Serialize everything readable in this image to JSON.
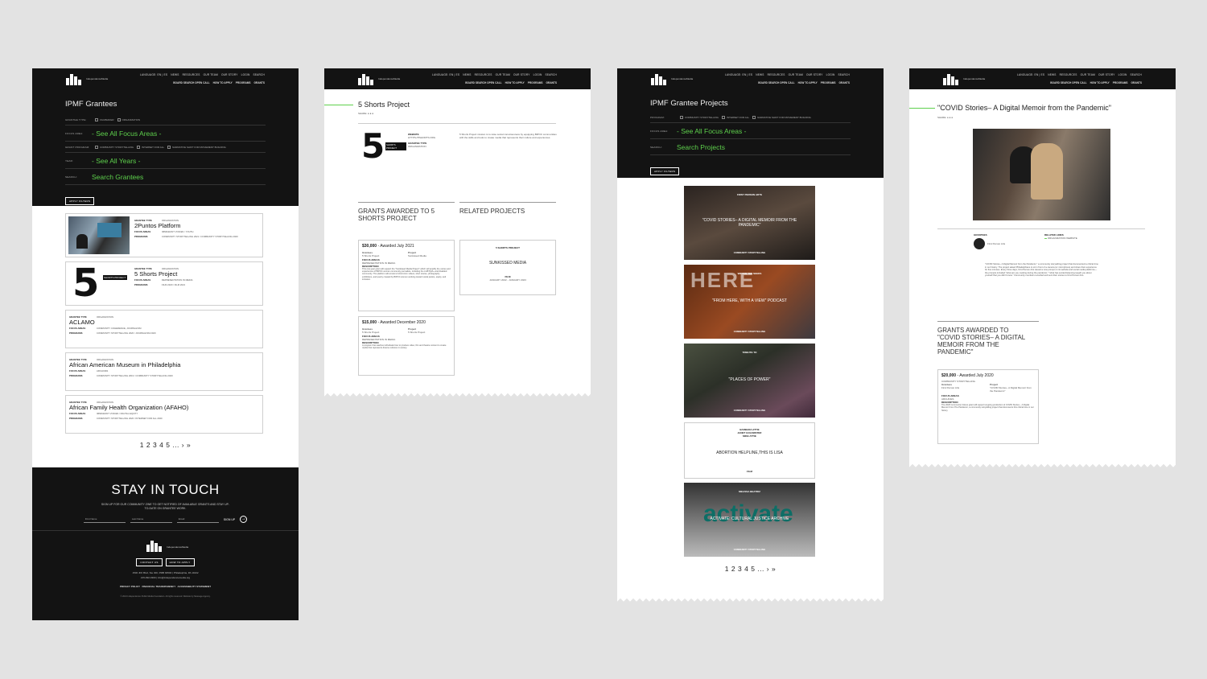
{
  "common": {
    "logo_text": "IndependenceMedia",
    "top_links": [
      "LANGUAGE: EN | ES",
      "NEWS",
      "RESOURCES",
      "OUR TEAM",
      "OUR STORY",
      "LOGIN",
      "SEARCH"
    ],
    "sub_links": [
      "BOARD SEARCH OPEN CALL",
      "HOW TO APPLY",
      "PROGRAMS",
      "GRANTS"
    ],
    "share_label": "SHARE:"
  },
  "panel1": {
    "title": "IPMF Grantees",
    "filters": {
      "grantee_type_label": "GRANTEE TYPE:",
      "grantee_type_options": [
        "FILMMAKER",
        "ORGANIZATION"
      ],
      "focus_area_label": "FOCUS AREA:",
      "focus_area_value": "- See All Focus Areas -",
      "grant_program_label": "GRANT PROGRAM:",
      "grant_program_options": [
        "COMMUNITY STORYTELLING",
        "INTERNET FOR ALL",
        "NARRATIVE SHIFT FOR MOVEMENT BUILDING"
      ],
      "year_label": "YEAR:",
      "year_value": "- See All Years -",
      "search_label": "SEARCH:",
      "search_value": "Search Grantees",
      "apply_label": "APPLY FILTERS"
    },
    "grantees": [
      {
        "type_label": "GRANTEE TYPE",
        "type": "ORGANIZATION",
        "name": "2Puntos Platform",
        "focus_label": "FOCUS AREAS",
        "focus": "IMMIGRANT VOICES / YOUTH",
        "programs_label": "PROGRAMS",
        "programs": "COMMUNITY STORYTELLING 2021 / COMMUNITY STORYTELLING 2020"
      },
      {
        "type_label": "GRANTEE TYPE",
        "type": "ORGANIZATION",
        "name": "5 Shorts Project",
        "focus_label": "FOCUS AREAS",
        "focus": "REPRESENTATION IN MEDIA",
        "programs_label": "PROGRAMS",
        "programs": "FILM 2020 / FILM 2021"
      },
      {
        "type_label": "GRANTEE TYPE",
        "type": "ORGANIZATION",
        "name": "ACLAMO",
        "focus_label": "FOCUS AREAS",
        "focus": "COMMUNITY COHERENCE, JOURNALISM",
        "programs_label": "PROGRAMS",
        "programs": "COMMUNITY STORYTELLING 2020 / JOURNALISM 2020"
      },
      {
        "type_label": "GRANTEE TYPE",
        "type": "ORGANIZATION",
        "name": "African American Museum in Philadelphia",
        "focus_label": "FOCUS AREAS",
        "focus": "ARCHIVES",
        "programs_label": "PROGRAMS",
        "programs": "COMMUNITY STORYTELLING 2019 / COMMUNITY STORYTELLING 2020"
      },
      {
        "type_label": "GRANTEE TYPE",
        "type": "ORGANIZATION",
        "name": "African Family Health Organization (AFAHO)",
        "focus_label": "FOCUS AREAS",
        "focus": "IMMIGRANT VOICES / DIGITAL EQUITY",
        "programs_label": "PROGRAMS",
        "programs": "COMMUNITY STORYTELLING 2020 / INTERNET FOR ALL 2020"
      }
    ],
    "pager": [
      "1",
      "2",
      "3",
      "4",
      "5",
      "...",
      "›",
      "»"
    ],
    "footer": {
      "heading": "STAY IN TOUCH",
      "subtext": "SIGN UP FOR OUR COMMUNITY ZINE TO GET NOTIFIED OF AVAILABLE GRANTS AND STAY UP-TO-DATE ON GRANTEE WORK.",
      "first_name_placeholder": "First Name",
      "last_name_placeholder": "Last Name",
      "email_placeholder": "Email",
      "signup_label": "SIGN UP",
      "contact_label": "CONTACT US",
      "apply_label": "HOW TO APPLY",
      "address": "1500 JFK Blvd, Ste 300, PMB 90500 | Philadelphia, PA 19102",
      "contact_line": "215-992-0300 | info@independencemedia.org",
      "legal_links": [
        "PRIVACY POLICY",
        "FINANCIAL TRANSPARENCY",
        "ACCESSIBILITY STATEMENT"
      ],
      "copyright": "© 2021 Independence Public Media Foundation. All rights reserved. Website by Message Agency."
    }
  },
  "panel2": {
    "title": "5 Shorts Project",
    "logo_big": "5",
    "logo_small": "SHORTS PROJECT",
    "website_label": "WEBSITE",
    "website": "HTTPS://5SHORTS.ORG",
    "grantee_type_label": "GRANTEE TYPE",
    "grantee_type": "ORGANIZATION",
    "description": "5 Shorts Project mission is to raise social consciousness by equipping BIPOC communities with the skills and tools to create media that represents their culture and experiences.",
    "grants_heading": "GRANTS AWARDED TO 5 SHORTS PROJECT",
    "related_heading": "RELATED PROJECTS",
    "grants": [
      {
        "amount": "$30,000",
        "awarded": "- Awarded July 2021",
        "grantees_label": "Grantees",
        "grantees": "5 Shorts Project",
        "project_label": "Project",
        "project": "Sunkissed Media",
        "focus_label": "FOCUS AREAS",
        "focus": "REPRESENTATION IN MEDIA",
        "desc_label": "DESCRIPTION",
        "desc": "This one-year grant will support the \"Sunkissed Media Project\" which will amplify the voices and experiences of BIPOC women community journalists, including the LGBTQIA+ and disabled community. The platform will consist of short-form videos, short stories, photography exhibitions, and poetry created by BIPOC women working toward social justice, equity, and inclusion."
      },
      {
        "amount": "$15,000",
        "awarded": "- Awarded December 2020",
        "grantees_label": "Grantees",
        "grantees": "5 Shorts Project",
        "project_label": "Project",
        "project": "5 Shorts Project",
        "focus_label": "FOCUS AREAS",
        "focus": "REPRESENTATION IN MEDIA",
        "desc_label": "DESCRIPTION",
        "desc": "A program that teaches individuals how to produce video, film and theatre content to create media that represents diverse cultures in society."
      }
    ],
    "related": {
      "by": "5 SHORTS PROJECT",
      "title": "SUNKISSED MEDIA",
      "category": "FILM",
      "dates": "JANUARY 2022 - JANUARY 2023"
    }
  },
  "panel3": {
    "title": "IPMF Grantee Projects",
    "program_label": "PROGRAM:",
    "program_options": [
      "COMMUNITY STORYTELLING",
      "INTERNET FOR ALL",
      "NARRATIVE SHIFT FOR MOVEMENT BUILDING"
    ],
    "focus_label": "FOCUS AREA:",
    "focus_value": "- See All Focus Areas -",
    "search_label": "SEARCH:",
    "search_value": "Search Projects",
    "apply_label": "APPLY FILTERS",
    "projects": [
      {
        "by": "FIRST PERSON ARTS",
        "title": "\"COVID STORIES– A DIGITAL MEMOIR FROM THE PANDEMIC\"",
        "category": "COMMUNITY STORYTELLING",
        "bg": "#3b3430"
      },
      {
        "by": "WE ARE THE SEEDS",
        "title": "\"FROM HERE, WITH A VIEW\" PODCAST",
        "category": "COMMUNITY STORYTELLING",
        "bg": "#7a3a1c",
        "bg_word": "HERE"
      },
      {
        "by": "TRIBUTE TO",
        "title": "\"PLACES OF POWER\"",
        "category": "COMMUNITY STORYTELLING",
        "bg": "#3e4338"
      },
      {
        "by": "BARBARA ATTIE\nJANET GOLDWATER\nMIKE ATTIE",
        "title": "ABORTION HELPLINE,THIS IS LISA",
        "category": "FILM",
        "bg": "#ffffff"
      },
      {
        "by": "MELISSA BEATRIZ",
        "title": "ACTIVATE: CULTURAL JUSTICE ARCHIVE",
        "category": "COMMUNITY STORYTELLING",
        "bg": "#555555",
        "bg_word": "activate"
      }
    ],
    "pager": [
      "1",
      "2",
      "3",
      "4",
      "5",
      "...",
      "›",
      "»"
    ]
  },
  "panel4": {
    "title": "\"COVID Stories– A Digital Memoir from the Pandemic\"",
    "grantees_label": "GRANTEES",
    "grantee": "First Person Arts",
    "related_label": "RELATED LINKS",
    "related_link": "ORGANIZATION WEBSITE",
    "description": "\"COVID Stories– A Digital Memoir from the Pandemic,\" a community storytelling project that documented a critical time in our history. The project asked Philadelphians to sit in front of a camera (or microphone) and share their experience for five minutes. Every three days, First Person Arts issued a new prompt on its website and social media platforms—the prompts included \"what are you cooking during the pandemic,\" \"what has social distancing taught you about yourself that you didn't know.\" Community members recorded and sent their stories to First Person Arts.",
    "grants_heading": "GRANTS AWARDED TO \"COVID STORIES– A DIGITAL MEMOIR FROM THE PANDEMIC\"",
    "grant": {
      "amount": "$20,000",
      "awarded": "- Awarded July 2020",
      "program": "COMMUNITY STORYTELLING",
      "grantees_label": "Grantees",
      "grantees": "First Person Arts",
      "project_label": "Project",
      "project": "\"COVID Stories– A Digital Memoir from the Pandemic\"",
      "focus_label": "FOCUS AREAS",
      "focus": "ARCHIVES",
      "desc_label": "DESCRIPTION",
      "desc": "The 2020 Community Voices grant will support ongoing production of COVID Stories – A Digital Memoir From The Pandemic, a community storytelling project that documents this critical time in our history."
    }
  },
  "colors": {
    "accent": "#5ed04c",
    "dark": "#131313",
    "background": "#e3e3e3"
  }
}
